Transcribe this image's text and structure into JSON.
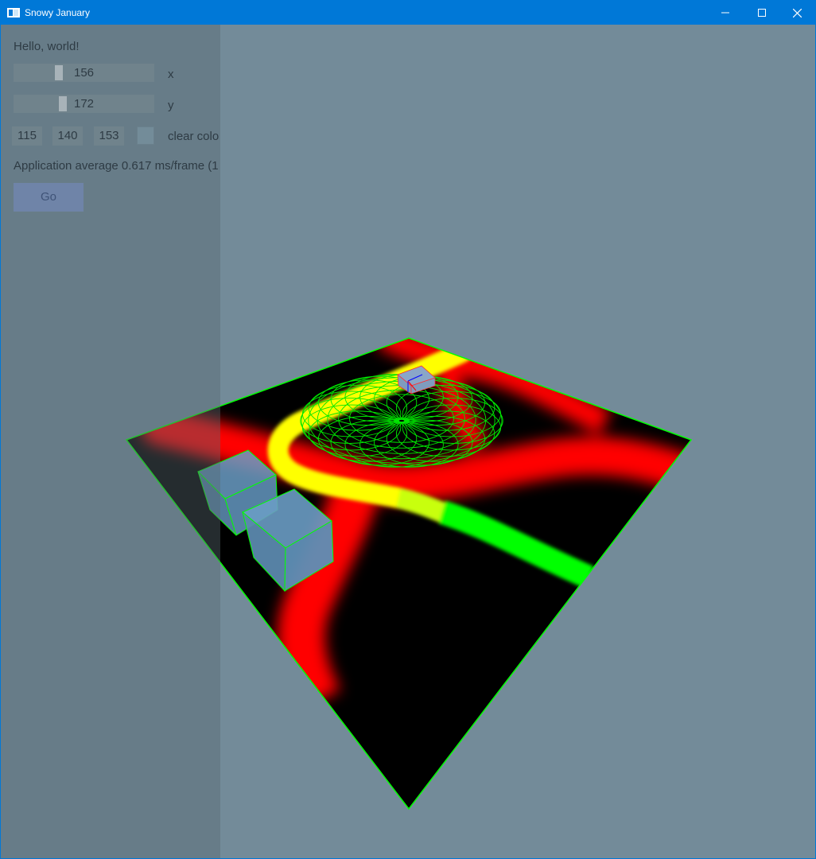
{
  "window": {
    "title": "Snowy January",
    "minimize_glyph": "minimize-icon",
    "maximize_glyph": "maximize-icon",
    "close_glyph": "close-icon"
  },
  "panel": {
    "greeting": "Hello, world!",
    "slider_x": {
      "value": "156",
      "label": "x"
    },
    "slider_y": {
      "value": "172",
      "label": "y"
    },
    "clear_color": {
      "r": "115",
      "g": "140",
      "b": "153",
      "label": "clear colo",
      "swatch_hex": "#738c99"
    },
    "perf_text": "Application average 0.617 ms/frame (1",
    "go_label": "Go"
  },
  "colors": {
    "title_bar": "#0078d7",
    "background": "#738b99",
    "road": "#ff0000",
    "path_yellow": "#ffff00",
    "path_green": "#00ff00",
    "wireframe": "#00ff00",
    "box_fill": "#5b86a6"
  }
}
